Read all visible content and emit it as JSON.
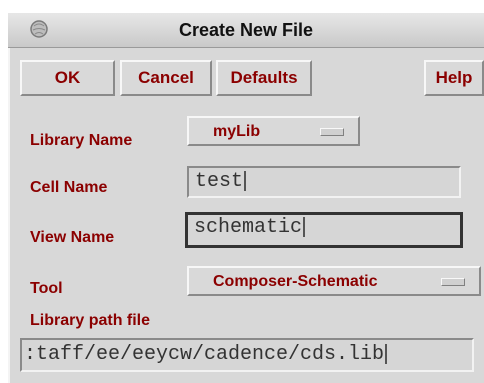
{
  "window": {
    "title": "Create New File",
    "icon": "window-menu-icon"
  },
  "buttons": {
    "ok": "OK",
    "cancel": "Cancel",
    "defaults": "Defaults",
    "help": "Help"
  },
  "form": {
    "library": {
      "label": "Library Name",
      "value": "myLib"
    },
    "cell": {
      "label": "Cell Name",
      "value": "test"
    },
    "view": {
      "label": "View Name",
      "value": "schematic"
    },
    "tool": {
      "label": "Tool",
      "value": "Composer-Schematic"
    },
    "libpath": {
      "label": "Library path file",
      "value": ":taff/ee/eeycw/cadence/cds.lib"
    }
  },
  "colors": {
    "label": "#8b0000",
    "panel": "#d8d8d8"
  }
}
